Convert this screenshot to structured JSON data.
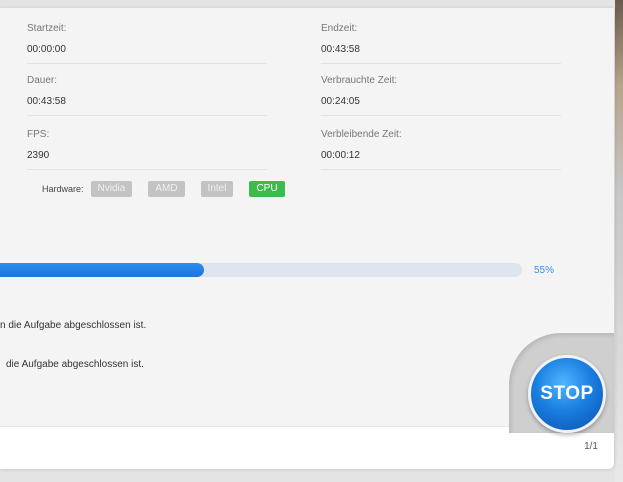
{
  "stats": {
    "start_label": "Startzeit:",
    "start_value": "00:00:00",
    "end_label": "Endzeit:",
    "end_value": "00:43:58",
    "duration_label": "Dauer:",
    "duration_value": "00:43:58",
    "elapsed_label": "Verbrauchte Zeit:",
    "elapsed_value": "00:24:05",
    "fps_label": "FPS:",
    "fps_value": "2390",
    "remaining_label": "Verbleibende Zeit:",
    "remaining_value": "00:00:12"
  },
  "hardware": {
    "label": "Hardware:",
    "options": [
      "Nvidia",
      "AMD",
      "Intel",
      "CPU"
    ],
    "active": "CPU",
    "active_color": "#3cba4c"
  },
  "progress": {
    "fraction": 0.39,
    "percent_label": "55%",
    "color": "#1a74de"
  },
  "messages": [
    "n die Aufgabe abgeschlossen ist.",
    "die Aufgabe abgeschlossen ist."
  ],
  "stop_button": {
    "label": "STOP"
  },
  "footer": {
    "pager": "1/1"
  }
}
